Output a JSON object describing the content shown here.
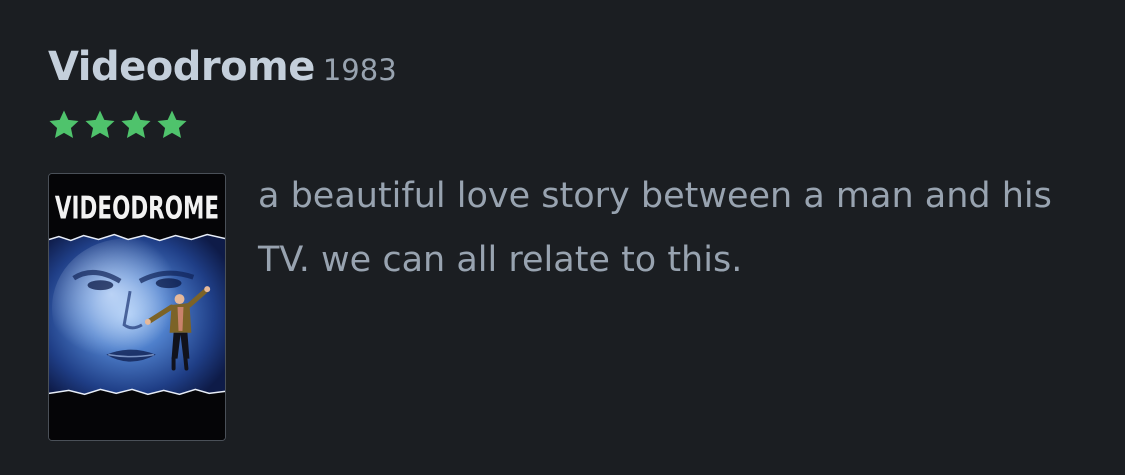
{
  "review": {
    "film_title": "Videodrome",
    "year": "1983",
    "rating_stars": 4,
    "rating_color": "#4fc36c",
    "text": "a beautiful love story between a man and his TV. we can all relate to this."
  },
  "poster": {
    "logo_text": "VIDEODROME"
  },
  "colors": {
    "background": "#1b1e22",
    "title": "#c4cfdb",
    "body_text": "#98a3b0"
  }
}
